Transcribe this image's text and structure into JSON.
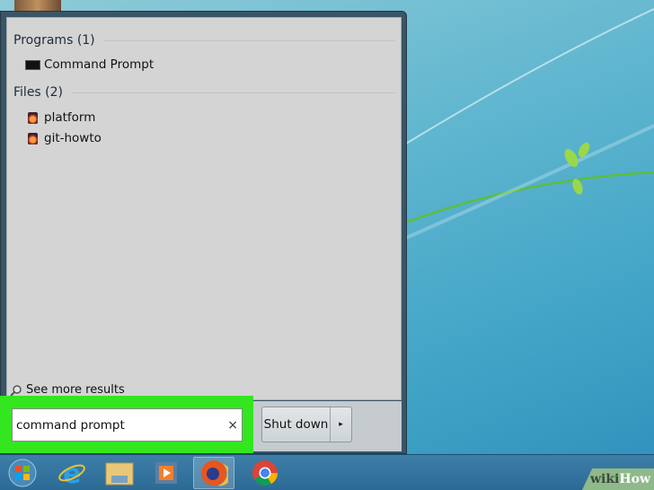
{
  "start_menu": {
    "groups": [
      {
        "title": "Programs (1)",
        "items": [
          {
            "label": "Command Prompt",
            "icon": "cmd-icon"
          }
        ]
      },
      {
        "title": "Files (2)",
        "items": [
          {
            "label": "platform",
            "icon": "firefox-document-icon"
          },
          {
            "label": "git-howto",
            "icon": "firefox-document-icon"
          }
        ]
      }
    ],
    "see_more": "See more results",
    "search": {
      "value": "command prompt",
      "clear": "×"
    },
    "shutdown": {
      "label": "Shut down",
      "arrow": "▸"
    }
  },
  "taskbar": {
    "items": [
      "start",
      "internet-explorer",
      "file-explorer",
      "media-player",
      "firefox",
      "chrome"
    ],
    "active": "firefox"
  },
  "watermark": {
    "part1": "wiki",
    "part2": "How"
  },
  "colors": {
    "highlight": "#33e61f"
  }
}
